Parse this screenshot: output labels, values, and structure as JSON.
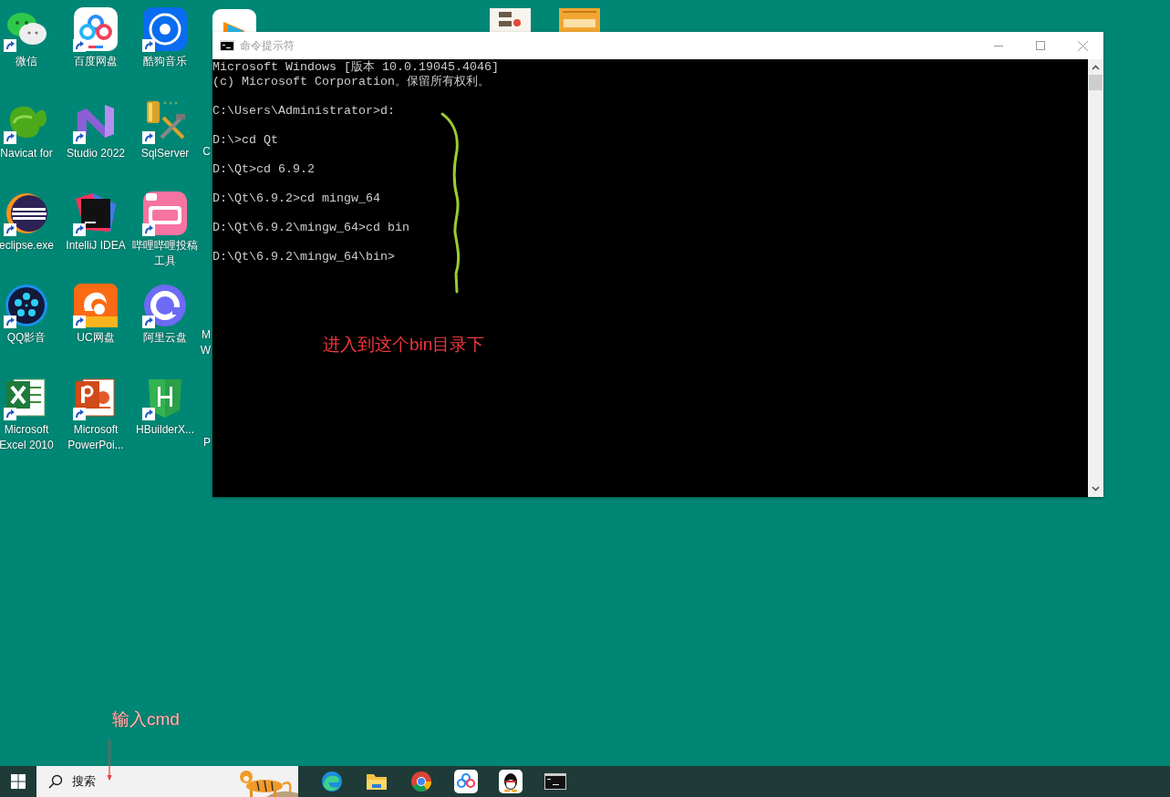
{
  "desktop": {
    "icons": [
      {
        "label": "微信"
      },
      {
        "label": "百度网盘"
      },
      {
        "label": "酷狗音乐"
      },
      {
        "label": "Navicat for"
      },
      {
        "label": "Studio 2022"
      },
      {
        "label": "SqlServer"
      },
      {
        "label": "eclipse.exe"
      },
      {
        "label": "IntelliJ IDEA"
      },
      {
        "label": "哔哩哔哩投稿工具"
      },
      {
        "label": "QQ影音"
      },
      {
        "label": "UC网盘"
      },
      {
        "label": "阿里云盘"
      },
      {
        "label": "Microsoft Excel 2010"
      },
      {
        "label": "Microsoft PowerPoi..."
      },
      {
        "label": "HBuilderX..."
      }
    ],
    "hidden_column_labels": [
      "C",
      "M",
      "W",
      "P"
    ]
  },
  "window": {
    "title": "命令提示符",
    "console_blocks": [
      [
        "Microsoft Windows [版本 10.0.19045.4046]",
        "(c) Microsoft Corporation。保留所有权利。"
      ],
      [
        "C:\\Users\\Administrator>d:"
      ],
      [
        "D:\\>cd Qt"
      ],
      [
        "D:\\Qt>cd 6.9.2"
      ],
      [
        "D:\\Qt\\6.9.2>cd mingw_64"
      ],
      [
        "D:\\Qt\\6.9.2\\mingw_64>cd bin"
      ],
      [
        "D:\\Qt\\6.9.2\\mingw_64\\bin>"
      ]
    ]
  },
  "annotations": [
    {
      "text": "进入到这个bin目录下"
    },
    {
      "text": "输入cmd"
    }
  ],
  "taskbar": {
    "search": {
      "placeholder": "搜索"
    }
  }
}
